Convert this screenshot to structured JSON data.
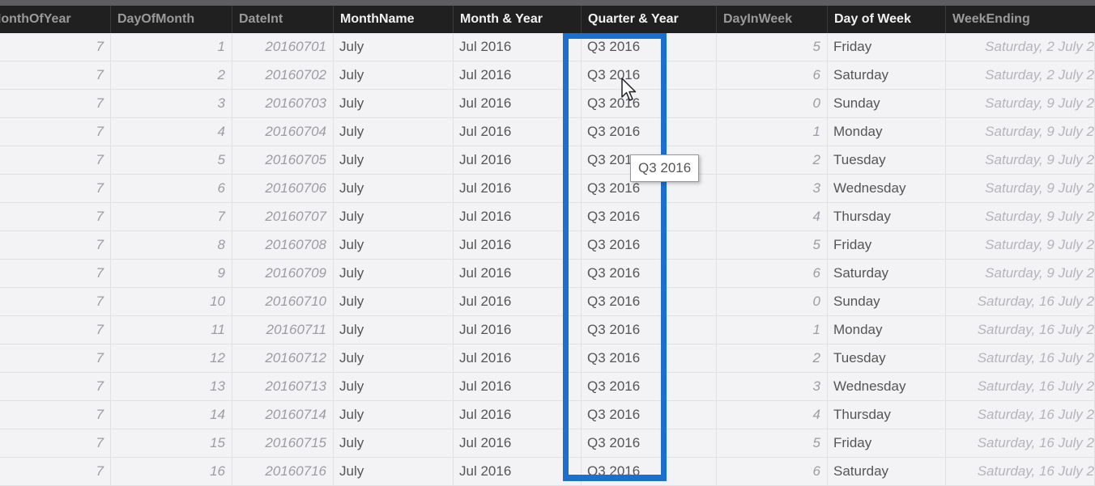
{
  "columns": [
    {
      "key": "monthofyear",
      "label": "MonthOfYear",
      "style": "dim"
    },
    {
      "key": "dayofmonth",
      "label": "DayOfMonth",
      "style": "dim"
    },
    {
      "key": "dateint",
      "label": "DateInt",
      "style": "dim"
    },
    {
      "key": "monthname",
      "label": "MonthName",
      "style": "bright"
    },
    {
      "key": "monthyear",
      "label": "Month & Year",
      "style": "bright"
    },
    {
      "key": "quarteryear",
      "label": "Quarter & Year",
      "style": "bright"
    },
    {
      "key": "dayinweek",
      "label": "DayInWeek",
      "style": "dim"
    },
    {
      "key": "dayofweek",
      "label": "Day of Week",
      "style": "bright"
    },
    {
      "key": "weekending",
      "label": "WeekEnding",
      "style": "dim"
    }
  ],
  "rows": [
    {
      "monthofyear": "7",
      "dayofmonth": "1",
      "dateint": "20160701",
      "monthname": "July",
      "monthyear": "Jul 2016",
      "quarteryear": "Q3 2016",
      "dayinweek": "5",
      "dayofweek": "Friday",
      "weekending": "Saturday, 2 July 2"
    },
    {
      "monthofyear": "7",
      "dayofmonth": "2",
      "dateint": "20160702",
      "monthname": "July",
      "monthyear": "Jul 2016",
      "quarteryear": "Q3 2016",
      "dayinweek": "6",
      "dayofweek": "Saturday",
      "weekending": "Saturday, 2 July 2"
    },
    {
      "monthofyear": "7",
      "dayofmonth": "3",
      "dateint": "20160703",
      "monthname": "July",
      "monthyear": "Jul 2016",
      "quarteryear": "Q3 2016",
      "dayinweek": "0",
      "dayofweek": "Sunday",
      "weekending": "Saturday, 9 July 2"
    },
    {
      "monthofyear": "7",
      "dayofmonth": "4",
      "dateint": "20160704",
      "monthname": "July",
      "monthyear": "Jul 2016",
      "quarteryear": "Q3 2016",
      "dayinweek": "1",
      "dayofweek": "Monday",
      "weekending": "Saturday, 9 July 2"
    },
    {
      "monthofyear": "7",
      "dayofmonth": "5",
      "dateint": "20160705",
      "monthname": "July",
      "monthyear": "Jul 2016",
      "quarteryear": "Q3 2016",
      "dayinweek": "2",
      "dayofweek": "Tuesday",
      "weekending": "Saturday, 9 July 2"
    },
    {
      "monthofyear": "7",
      "dayofmonth": "6",
      "dateint": "20160706",
      "monthname": "July",
      "monthyear": "Jul 2016",
      "quarteryear": "Q3 2016",
      "dayinweek": "3",
      "dayofweek": "Wednesday",
      "weekending": "Saturday, 9 July 2"
    },
    {
      "monthofyear": "7",
      "dayofmonth": "7",
      "dateint": "20160707",
      "monthname": "July",
      "monthyear": "Jul 2016",
      "quarteryear": "Q3 2016",
      "dayinweek": "4",
      "dayofweek": "Thursday",
      "weekending": "Saturday, 9 July 2"
    },
    {
      "monthofyear": "7",
      "dayofmonth": "8",
      "dateint": "20160708",
      "monthname": "July",
      "monthyear": "Jul 2016",
      "quarteryear": "Q3 2016",
      "dayinweek": "5",
      "dayofweek": "Friday",
      "weekending": "Saturday, 9 July 2"
    },
    {
      "monthofyear": "7",
      "dayofmonth": "9",
      "dateint": "20160709",
      "monthname": "July",
      "monthyear": "Jul 2016",
      "quarteryear": "Q3 2016",
      "dayinweek": "6",
      "dayofweek": "Saturday",
      "weekending": "Saturday, 9 July 2"
    },
    {
      "monthofyear": "7",
      "dayofmonth": "10",
      "dateint": "20160710",
      "monthname": "July",
      "monthyear": "Jul 2016",
      "quarteryear": "Q3 2016",
      "dayinweek": "0",
      "dayofweek": "Sunday",
      "weekending": "Saturday, 16 July 2"
    },
    {
      "monthofyear": "7",
      "dayofmonth": "11",
      "dateint": "20160711",
      "monthname": "July",
      "monthyear": "Jul 2016",
      "quarteryear": "Q3 2016",
      "dayinweek": "1",
      "dayofweek": "Monday",
      "weekending": "Saturday, 16 July 2"
    },
    {
      "monthofyear": "7",
      "dayofmonth": "12",
      "dateint": "20160712",
      "monthname": "July",
      "monthyear": "Jul 2016",
      "quarteryear": "Q3 2016",
      "dayinweek": "2",
      "dayofweek": "Tuesday",
      "weekending": "Saturday, 16 July 2"
    },
    {
      "monthofyear": "7",
      "dayofmonth": "13",
      "dateint": "20160713",
      "monthname": "July",
      "monthyear": "Jul 2016",
      "quarteryear": "Q3 2016",
      "dayinweek": "3",
      "dayofweek": "Wednesday",
      "weekending": "Saturday, 16 July 2"
    },
    {
      "monthofyear": "7",
      "dayofmonth": "14",
      "dateint": "20160714",
      "monthname": "July",
      "monthyear": "Jul 2016",
      "quarteryear": "Q3 2016",
      "dayinweek": "4",
      "dayofweek": "Thursday",
      "weekending": "Saturday, 16 July 2"
    },
    {
      "monthofyear": "7",
      "dayofmonth": "15",
      "dateint": "20160715",
      "monthname": "July",
      "monthyear": "Jul 2016",
      "quarteryear": "Q3 2016",
      "dayinweek": "5",
      "dayofweek": "Friday",
      "weekending": "Saturday, 16 July 2"
    },
    {
      "monthofyear": "7",
      "dayofmonth": "16",
      "dateint": "20160716",
      "monthname": "July",
      "monthyear": "Jul 2016",
      "quarteryear": "Q3 2016",
      "dayinweek": "6",
      "dayofweek": "Saturday",
      "weekending": "Saturday, 16 July 2"
    }
  ],
  "tooltip": {
    "text": "Q3 2016"
  },
  "highlight": {
    "column": "quarteryear",
    "color": "#1a6fcf"
  }
}
